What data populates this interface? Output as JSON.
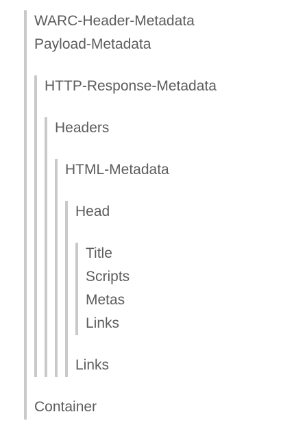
{
  "tree": {
    "root": {
      "items": [
        "WARC-Header-Metadata",
        "Payload-Metadata",
        "Container"
      ],
      "http_response_metadata": {
        "label": "HTTP-Response-Metadata",
        "headers": {
          "label": "Headers",
          "html_metadata": {
            "label": "HTML-Metadata",
            "head": {
              "label": "Head",
              "items": [
                "Title",
                "Scripts",
                "Metas",
                "Links"
              ]
            },
            "links_label": "Links"
          }
        }
      }
    }
  }
}
